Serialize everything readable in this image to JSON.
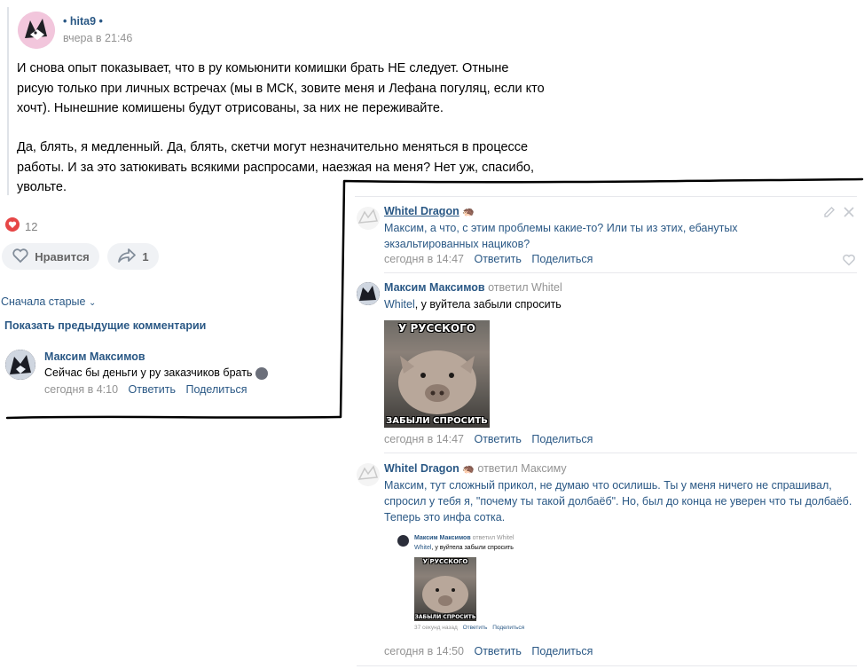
{
  "post": {
    "author": "• hita9 •",
    "time": "вчера в 21:46",
    "para1": "И снова опыт показывает, что в ру комьюнити комишки брать НЕ следует. Отныне рисую только при личных встречах (мы в МСК, зовите меня и Лефана погуляц, если кто хочт). Нынешние комишены будут отрисованы, за них не переживайте.",
    "para2": "Да, блять, я медленный. Да, блять, скетчи могут незначительно меняться в процессе работы. И за это затюкивать всякими распросами, наезжая на меня? Нет уж, спасибо, увольте.",
    "likes_count": "12",
    "like_label": "Нравится",
    "share_count": "1"
  },
  "comments_header": {
    "sort_label": "Сначала старые",
    "show_prev": "Показать предыдущие комментарии"
  },
  "comment_left": {
    "author": "Максим Максимов",
    "text": "Сейчас бы деньги у ру заказчиков брать",
    "time": "сегодня в 4:10",
    "reply": "Ответить",
    "share": "Поделиться"
  },
  "thread": [
    {
      "author": "Whitel Dragon",
      "text": "Максим, а что, с этим проблемы какие-то? Или ты из этих, ебанутых экзальтированных нациков?",
      "time": "сегодня в 14:47",
      "reply": "Ответить",
      "share": "Поделиться"
    },
    {
      "author": "Максим Максимов",
      "replied": "ответил Whitel",
      "mention": "Whitel",
      "text": ", у вуйтела забыли спросить",
      "meme_top": "У РУССКОГО",
      "meme_bottom": "ЗАБЫЛИ СПРОСИТЬ",
      "time": "сегодня в 14:47",
      "reply": "Ответить",
      "share": "Поделиться"
    },
    {
      "author": "Whitel Dragon",
      "replied": "ответил Максиму",
      "mention": "Максим",
      "text": ", тут сложный прикол, не думаю что осилишь. Ты у меня ничего не спрашивал, спросил у тебя я, \"почему ты такой долбаёб\". Но, был до конца не уверен что ты долбаёб. Теперь это инфа сотка.",
      "time": "сегодня в 14:50",
      "reply": "Ответить",
      "share": "Поделиться"
    }
  ],
  "embedded": {
    "author": "Максим Максимов",
    "replied": "ответил Whitel",
    "mention": "Whitel",
    "text": ", у вуйтела забыли спросить",
    "meme_top": "У РУССКОГО",
    "meme_bottom": "ЗАБЫЛИ СПРОСИТЬ",
    "time": "37 секунд назад",
    "reply": "Ответить",
    "share": "Поделиться"
  },
  "colors": {
    "link": "#2a5885",
    "meta": "#939393",
    "heart": "#e64646",
    "pill": "#f0f2f5"
  },
  "icons": [
    "heart-icon",
    "share-icon",
    "edit-icon",
    "close-icon",
    "like-outline-icon",
    "emoji-icon",
    "hedgehog-icon"
  ]
}
